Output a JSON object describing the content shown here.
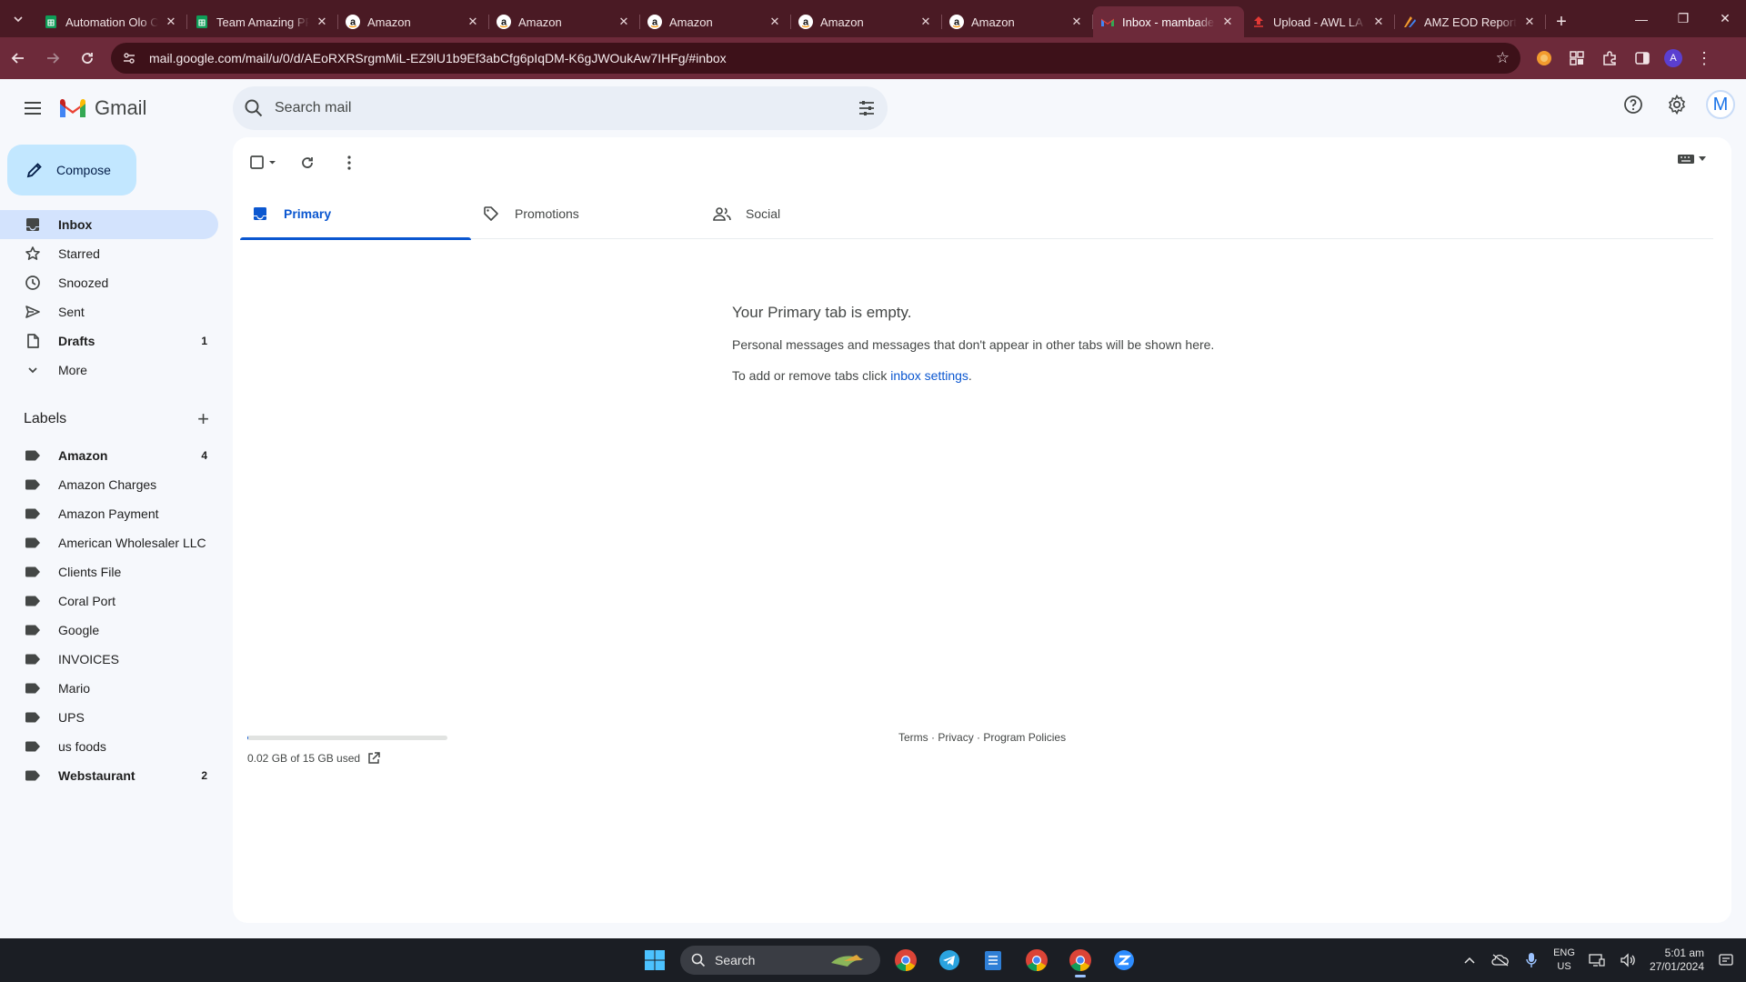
{
  "browser": {
    "tabs": [
      {
        "title": "Automation Olo C",
        "favicon": "sheets-icon"
      },
      {
        "title": "Team Amazing PR",
        "favicon": "sheets-icon"
      },
      {
        "title": "Amazon",
        "favicon": "amazon-icon"
      },
      {
        "title": "Amazon",
        "favicon": "amazon-icon"
      },
      {
        "title": "Amazon",
        "favicon": "amazon-icon"
      },
      {
        "title": "Amazon",
        "favicon": "amazon-icon"
      },
      {
        "title": "Amazon",
        "favicon": "amazon-icon"
      },
      {
        "title": "Inbox - mambade",
        "favicon": "gmail-icon",
        "active": true
      },
      {
        "title": "Upload - AWL LA",
        "favicon": "upload-icon"
      },
      {
        "title": "AMZ EOD Report",
        "favicon": "report-icon"
      }
    ],
    "url": "mail.google.com/mail/u/0/d/AEoRXRSrgmMiL-EZ9lU1b9Ef3abCfg6pIqDM-K6gJWOukAw7IHFg/#inbox",
    "profile_initial": "A",
    "theme_color": "#6d2a3a"
  },
  "gmail": {
    "logo_text": "Gmail",
    "search_placeholder": "Search mail",
    "account_initial": "M",
    "compose_label": "Compose",
    "nav": [
      {
        "label": "Inbox",
        "icon": "inbox-icon",
        "count": "",
        "active": true
      },
      {
        "label": "Starred",
        "icon": "star-icon",
        "count": ""
      },
      {
        "label": "Snoozed",
        "icon": "clock-icon",
        "count": ""
      },
      {
        "label": "Sent",
        "icon": "send-icon",
        "count": ""
      },
      {
        "label": "Drafts",
        "icon": "draft-icon",
        "count": "1",
        "bold": true
      },
      {
        "label": "More",
        "icon": "chevron-down-icon",
        "count": ""
      }
    ],
    "labels_title": "Labels",
    "labels": [
      {
        "label": "Amazon",
        "count": "4",
        "bold": true
      },
      {
        "label": "Amazon Charges",
        "count": ""
      },
      {
        "label": "Amazon Payment",
        "count": ""
      },
      {
        "label": "American Wholesaler LLC",
        "count": ""
      },
      {
        "label": "Clients File",
        "count": ""
      },
      {
        "label": "Coral Port",
        "count": ""
      },
      {
        "label": "Google",
        "count": ""
      },
      {
        "label": "INVOICES",
        "count": ""
      },
      {
        "label": "Mario",
        "count": ""
      },
      {
        "label": "UPS",
        "count": ""
      },
      {
        "label": "us foods",
        "count": ""
      },
      {
        "label": "Webstaurant",
        "count": "2",
        "bold": true
      }
    ],
    "categories": [
      {
        "label": "Primary",
        "icon": "inbox-icon",
        "active": true
      },
      {
        "label": "Promotions",
        "icon": "tag-icon"
      },
      {
        "label": "Social",
        "icon": "people-icon"
      }
    ],
    "empty": {
      "title": "Your Primary tab is empty.",
      "line1": "Personal messages and messages that don't appear in other tabs will be shown here.",
      "line2_prefix": "To add or remove tabs click ",
      "line2_link": "inbox settings",
      "line2_suffix": "."
    },
    "storage": {
      "text": "0.02 GB of 15 GB used",
      "fraction": 0.0013
    },
    "footer": {
      "terms": "Terms",
      "privacy": "Privacy",
      "policies": "Program Policies",
      "separator": "·"
    },
    "accent_color": "#0b57d0"
  },
  "taskbar": {
    "search_label": "Search",
    "lang_top": "ENG",
    "lang_bottom": "US",
    "time": "5:01 am",
    "date": "27/01/2024"
  }
}
